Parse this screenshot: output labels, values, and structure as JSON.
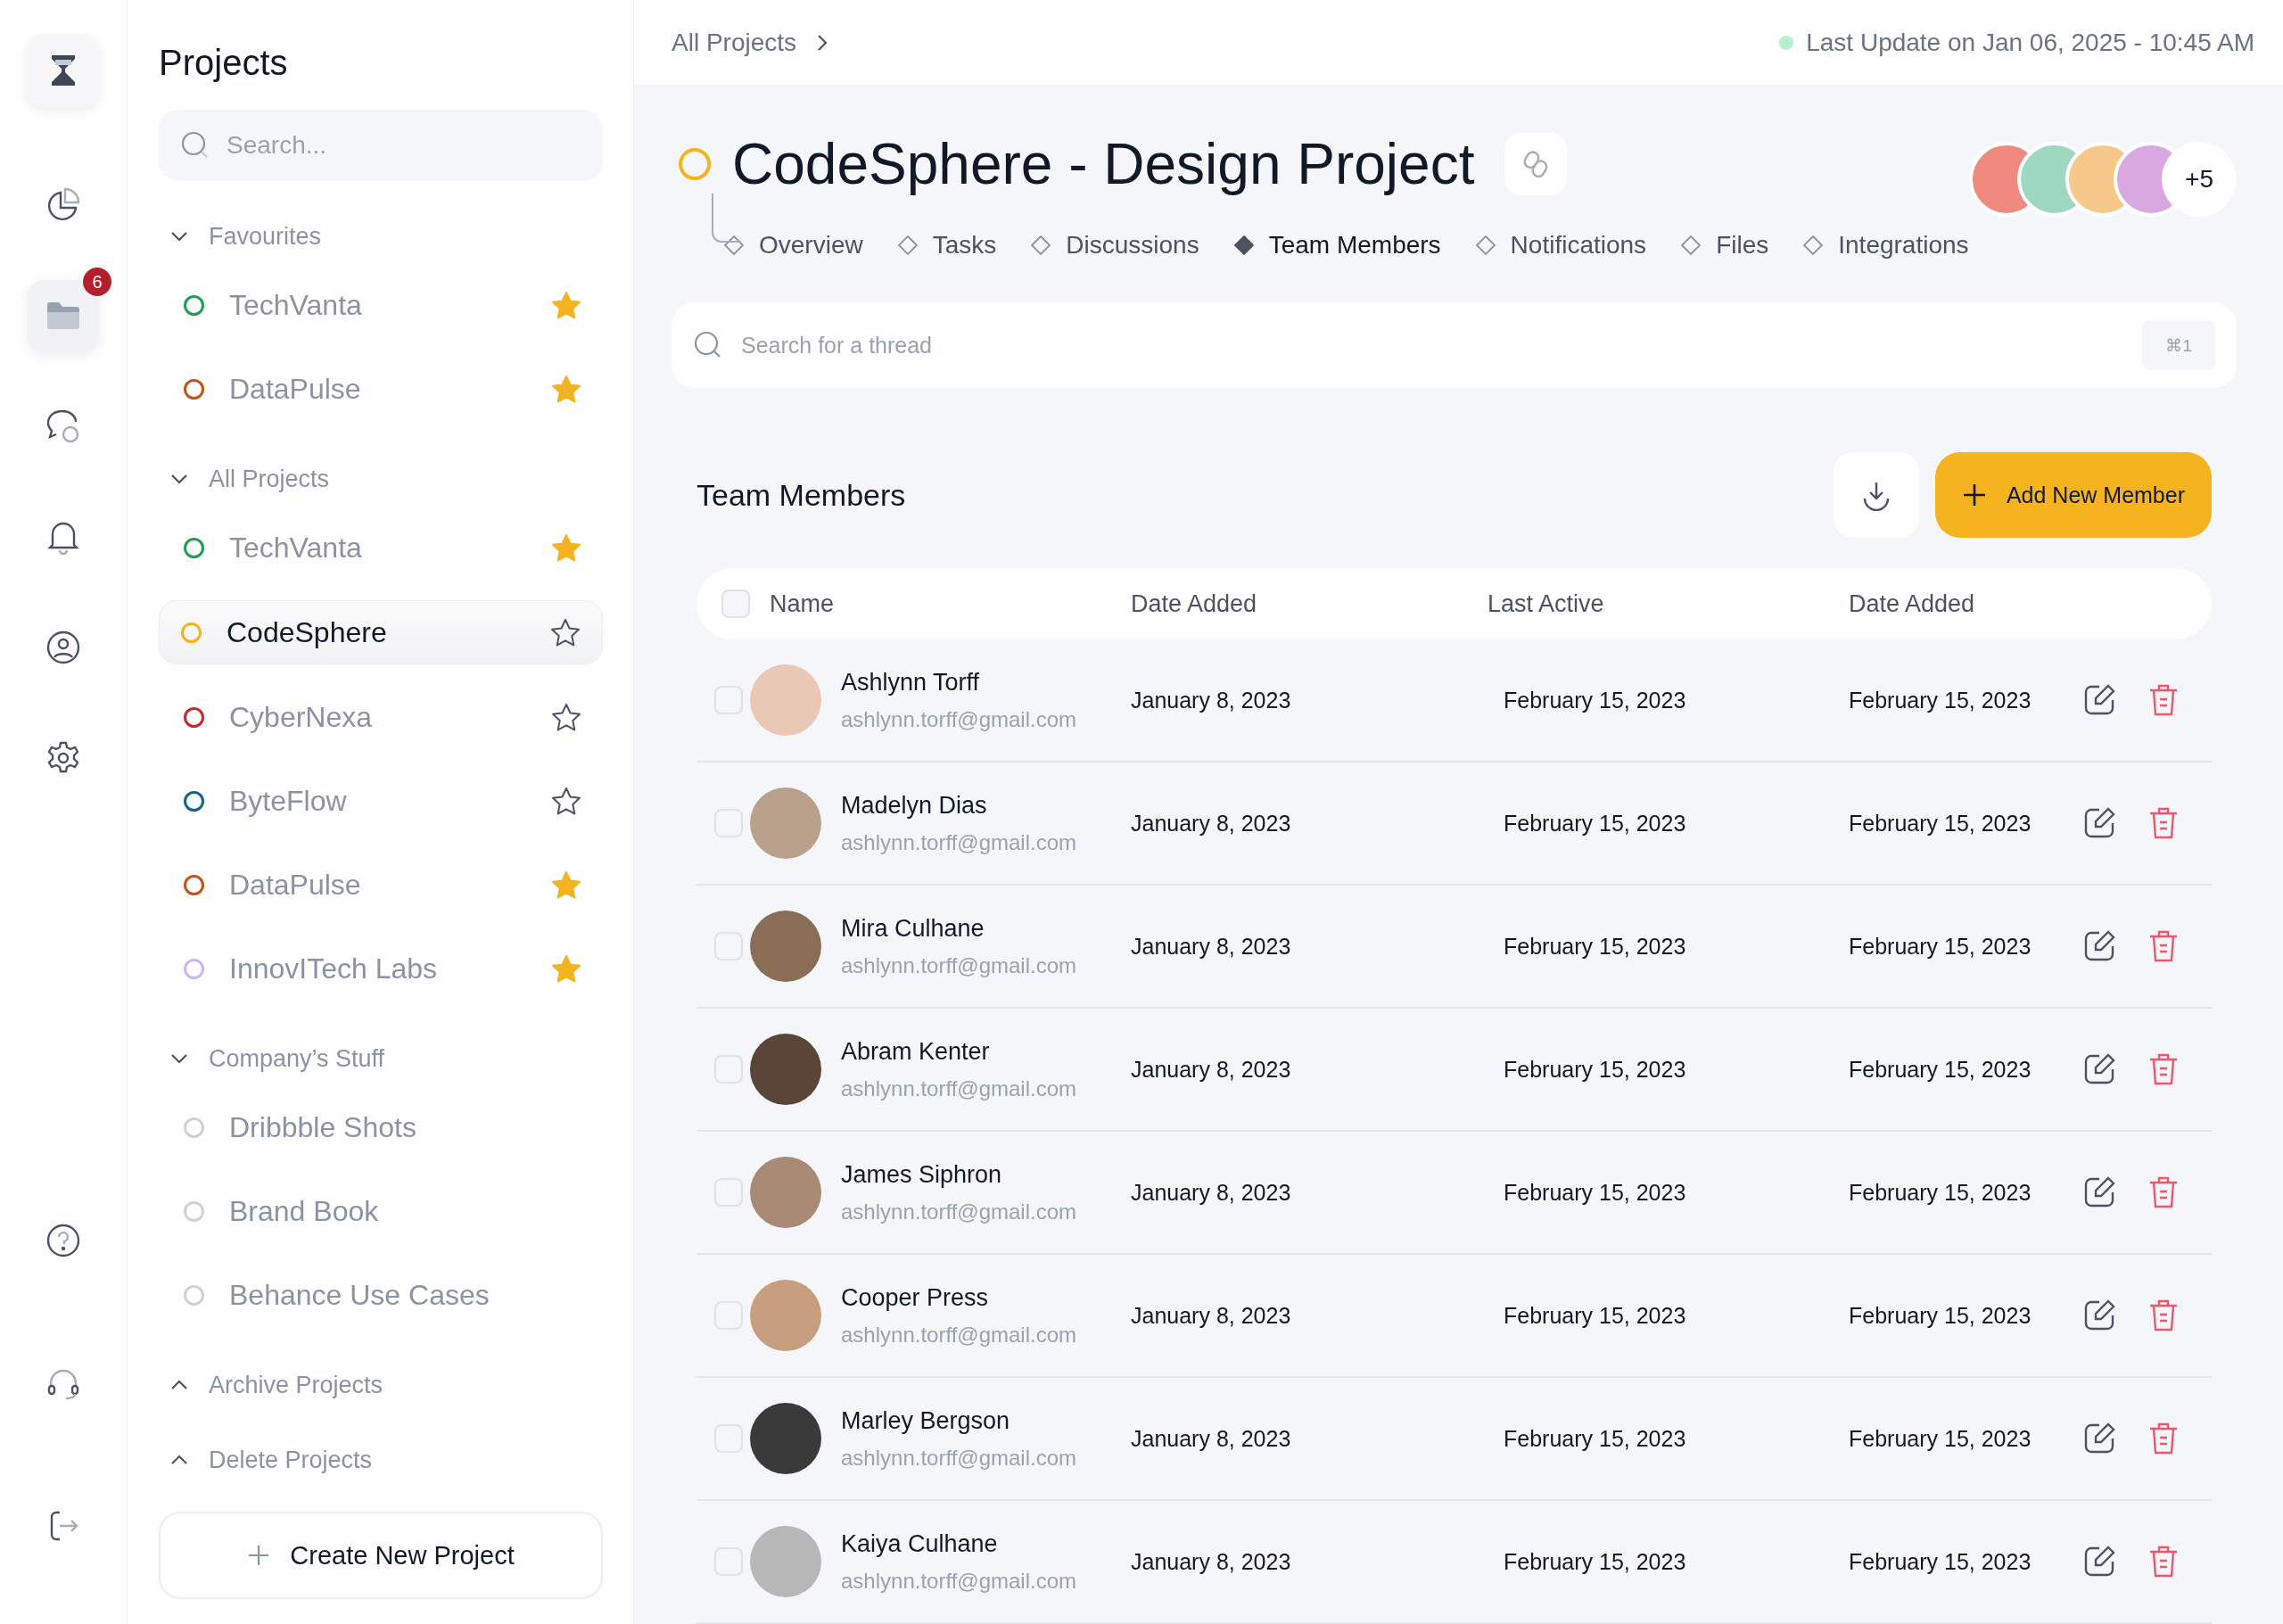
{
  "rail": {
    "badge": "6",
    "items": [
      {
        "kind": "pie",
        "selected": false
      },
      {
        "kind": "folder",
        "selected": true
      },
      {
        "kind": "chat",
        "selected": false
      },
      {
        "kind": "bell",
        "selected": false
      },
      {
        "kind": "user",
        "selected": false
      },
      {
        "kind": "settings",
        "selected": false
      }
    ],
    "bottom": [
      {
        "kind": "help"
      },
      {
        "kind": "headset"
      },
      {
        "kind": "logout"
      }
    ]
  },
  "sidebar": {
    "title": "Projects",
    "search": {
      "placeholder": "Search..."
    },
    "sections": [
      {
        "label": "Favourites",
        "expanded": true,
        "items": [
          {
            "label": "TechVanta",
            "color": "#1f9d55",
            "starred": true,
            "selected": false
          },
          {
            "label": "DataPulse",
            "color": "#c0561b",
            "starred": true,
            "selected": false
          }
        ]
      },
      {
        "label": "All Projects",
        "expanded": true,
        "items": [
          {
            "label": "TechVanta",
            "color": "#1f9d55",
            "starred": true,
            "selected": false
          },
          {
            "label": "CodeSphere",
            "color": "#f5b31f",
            "starred": false,
            "selected": true
          },
          {
            "label": "CyberNexa",
            "color": "#c42a2a",
            "starred": false,
            "selected": false
          },
          {
            "label": "ByteFlow",
            "color": "#14648c",
            "starred": false,
            "selected": false
          },
          {
            "label": "DataPulse",
            "color": "#c0561b",
            "starred": true,
            "selected": false
          },
          {
            "label": "InnovITech Labs",
            "color": "#c9b6f7",
            "starred": true,
            "selected": false
          }
        ]
      },
      {
        "label": "Company’s Stuff",
        "expanded": true,
        "items": [
          {
            "label": "Dribbble Shots",
            "color": "#cdd1da",
            "selected": false
          },
          {
            "label": "Brand Book",
            "color": "#cdd1da",
            "selected": false
          },
          {
            "label": "Behance Use Cases",
            "color": "#cdd1da",
            "selected": false
          }
        ]
      },
      {
        "label": "Archive Projects",
        "expanded": false
      },
      {
        "label": "Delete Projects",
        "expanded": false
      }
    ],
    "create_button": "Create New Project"
  },
  "header": {
    "breadcrumb": "All Projects",
    "last_update": "Last Update on Jan 06, 2025 - 10:45 AM"
  },
  "project": {
    "title": "CodeSphere - Design Project",
    "extra_members": "+5",
    "tabs": [
      {
        "label": "Overview",
        "selected": false
      },
      {
        "label": "Tasks",
        "selected": false
      },
      {
        "label": "Discussions",
        "selected": false
      },
      {
        "label": "Team Members",
        "selected": true
      },
      {
        "label": "Notifications",
        "selected": false
      },
      {
        "label": "Files",
        "selected": false
      },
      {
        "label": "Integrations",
        "selected": false
      }
    ],
    "thread_search": {
      "placeholder": "Search for a thread",
      "shortcut": "⌘1"
    }
  },
  "team": {
    "title": "Team Members",
    "add_button": "Add New Member",
    "columns": [
      "Name",
      "Date Added",
      "Last Active",
      "Date Added"
    ],
    "header_checked": false,
    "rows": [
      {
        "name": "Ashlynn Torff",
        "email": "ashlynn.torff@gmail.com",
        "date_added": "January 8, 2023",
        "last_active": "February 15, 2023",
        "date_added_2": "February 15, 2023",
        "checked": false
      },
      {
        "name": "Madelyn Dias",
        "email": "ashlynn.torff@gmail.com",
        "date_added": "January 8, 2023",
        "last_active": "February 15, 2023",
        "date_added_2": "February 15, 2023",
        "checked": false
      },
      {
        "name": "Mira Culhane",
        "email": "ashlynn.torff@gmail.com",
        "date_added": "January 8, 2023",
        "last_active": "February 15, 2023",
        "date_added_2": "February 15, 2023",
        "checked": false
      },
      {
        "name": "Abram Kenter",
        "email": "ashlynn.torff@gmail.com",
        "date_added": "January 8, 2023",
        "last_active": "February 15, 2023",
        "date_added_2": "February 15, 2023",
        "checked": false
      },
      {
        "name": "James Siphron",
        "email": "ashlynn.torff@gmail.com",
        "date_added": "January 8, 2023",
        "last_active": "February 15, 2023",
        "date_added_2": "February 15, 2023",
        "checked": false
      },
      {
        "name": "Cooper Press",
        "email": "ashlynn.torff@gmail.com",
        "date_added": "January 8, 2023",
        "last_active": "February 15, 2023",
        "date_added_2": "February 15, 2023",
        "checked": false
      },
      {
        "name": "Marley Bergson",
        "email": "ashlynn.torff@gmail.com",
        "date_added": "January 8, 2023",
        "last_active": "February 15, 2023",
        "date_added_2": "February 15, 2023",
        "checked": false
      },
      {
        "name": "Kaiya Culhane",
        "email": "ashlynn.torff@gmail.com",
        "date_added": "January 8, 2023",
        "last_active": "February 15, 2023",
        "date_added_2": "February 15, 2023",
        "checked": false
      }
    ]
  }
}
